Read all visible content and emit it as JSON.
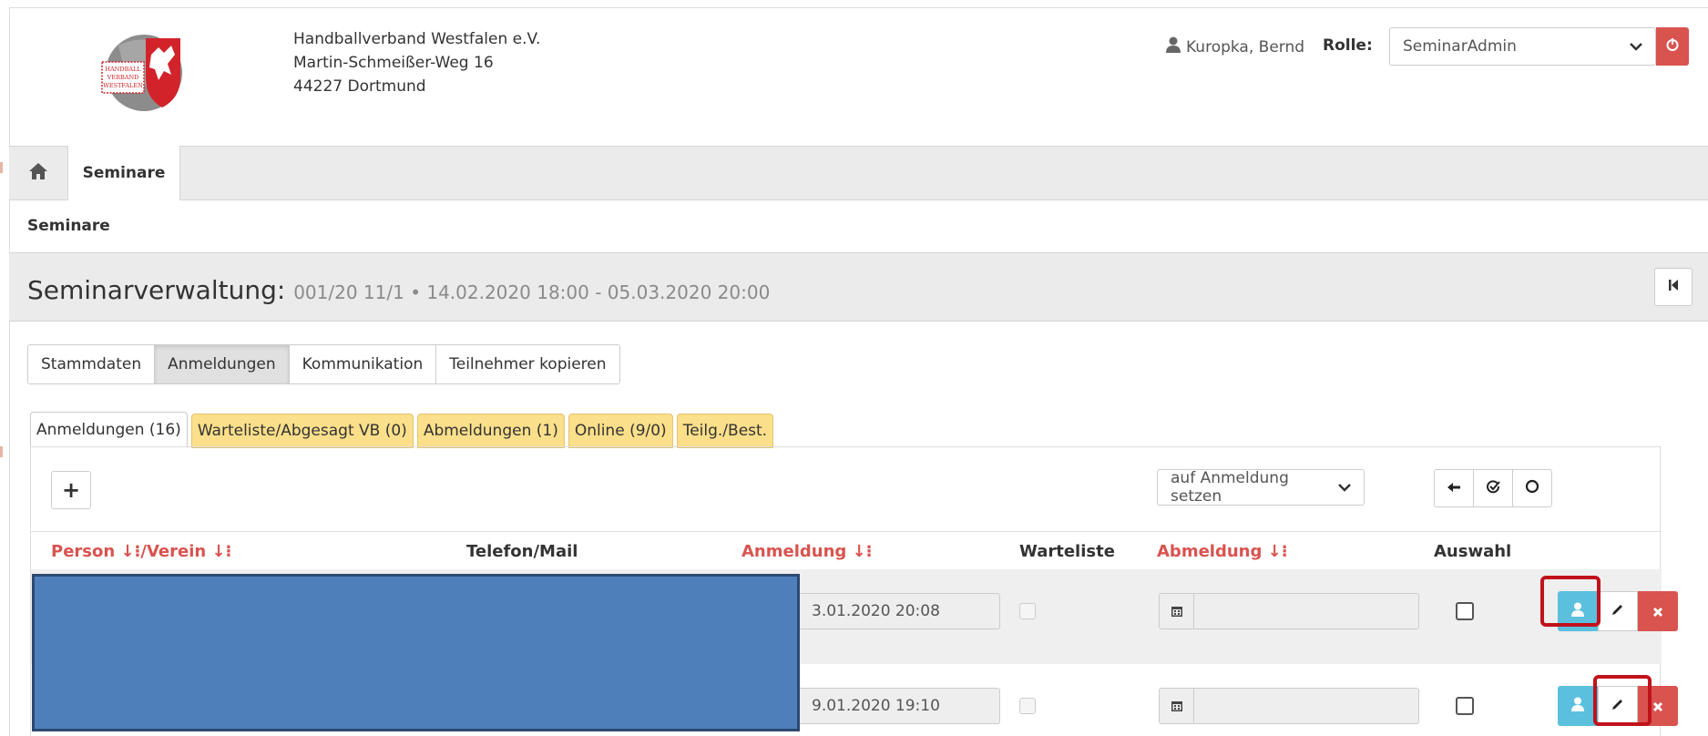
{
  "org": {
    "line1": "Handballverband Westfalen e.V.",
    "line2": "Martin-Schmeißer-Weg 16",
    "line3": "44227 Dortmund"
  },
  "logo": {
    "text1": "HANDBALL",
    "text2": "VERBAND",
    "text3": "WESTFALEN"
  },
  "user": {
    "name": "Kuropka, Bernd",
    "role_label": "Rolle:",
    "role_value": "SeminarAdmin"
  },
  "nav": {
    "home": "home",
    "active_tab": "Seminare"
  },
  "breadcrumb": "Seminare",
  "title": {
    "main": "Seminarverwaltung:",
    "sub": "001/20 11/1 • 14.02.2020 18:00 - 05.03.2020 20:00"
  },
  "main_tabs": [
    "Stammdaten",
    "Anmeldungen",
    "Kommunikation",
    "Teilnehmer kopieren"
  ],
  "sub_tabs": [
    "Anmeldungen (16)",
    "Warteliste/Abgesagt VB (0)",
    "Abmeldungen (1)",
    "Online (9/0)",
    "Teilg./Best."
  ],
  "toolbar": {
    "add": "+",
    "action_select": "auf Anmeldung setzen"
  },
  "table": {
    "headers": {
      "person": "Person",
      "verein": "/Verein",
      "telefon": "Telefon/Mail",
      "anmeldung": "Anmeldung",
      "warteliste": "Warteliste",
      "abmeldung": "Abmeldung",
      "auswahl": "Auswahl"
    },
    "sort_icon": "↓⁝",
    "rows": [
      {
        "anmeldung": "3.01.2020 20:08",
        "abmeldung": ""
      },
      {
        "anmeldung": "9.01.2020 19:10",
        "abmeldung": ""
      }
    ]
  },
  "colors": {
    "danger": "#d9534f",
    "info": "#5bc0de",
    "warning_tab": "#fbdf8a",
    "highlight": "#c0121b",
    "redaction": "#4f7fbb"
  }
}
